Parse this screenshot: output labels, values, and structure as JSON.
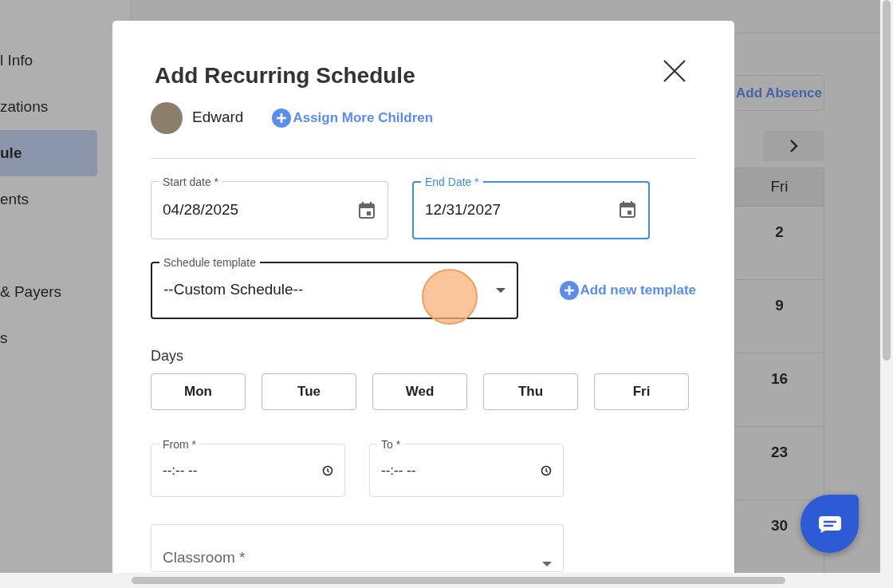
{
  "sidebar": {
    "sections": [
      {
        "items": [
          {
            "label": "l Info",
            "selected": false
          },
          {
            "label": "zations",
            "selected": false
          },
          {
            "label": "ule",
            "selected": true
          },
          {
            "label": "ents",
            "selected": false
          }
        ]
      },
      {
        "items": [
          {
            "label": "& Payers",
            "selected": false
          },
          {
            "label": "s",
            "selected": false
          }
        ]
      }
    ]
  },
  "page": {
    "add_absence_button": "Add Absence",
    "calendar": {
      "column_header": "Fri",
      "days": [
        "2",
        "9",
        "16",
        "23",
        "30"
      ]
    }
  },
  "modal": {
    "title": "Add Recurring Schedule",
    "child": {
      "name": "Edward"
    },
    "assign_link": "Assign More Children",
    "dates": [
      {
        "label": "Start date *",
        "value": "04/28/2025",
        "focused": false
      },
      {
        "label": "End Date *",
        "value": "12/31/2027",
        "focused": true
      }
    ],
    "schedule_template": {
      "label": "Schedule template",
      "value": "--Custom Schedule--",
      "hovered": true
    },
    "add_template_link": "Add new template",
    "days_label": "Days",
    "days": [
      {
        "label": "Mon",
        "selected": false
      },
      {
        "label": "Tue",
        "selected": false
      },
      {
        "label": "Wed",
        "selected": false
      },
      {
        "label": "Thu",
        "selected": false
      },
      {
        "label": "Fri",
        "selected": false
      }
    ],
    "times": [
      {
        "label": "From *",
        "value": "--:-- --"
      },
      {
        "label": "To *",
        "value": "--:-- --"
      }
    ],
    "classroom": {
      "placeholder": "Classroom *"
    }
  }
}
